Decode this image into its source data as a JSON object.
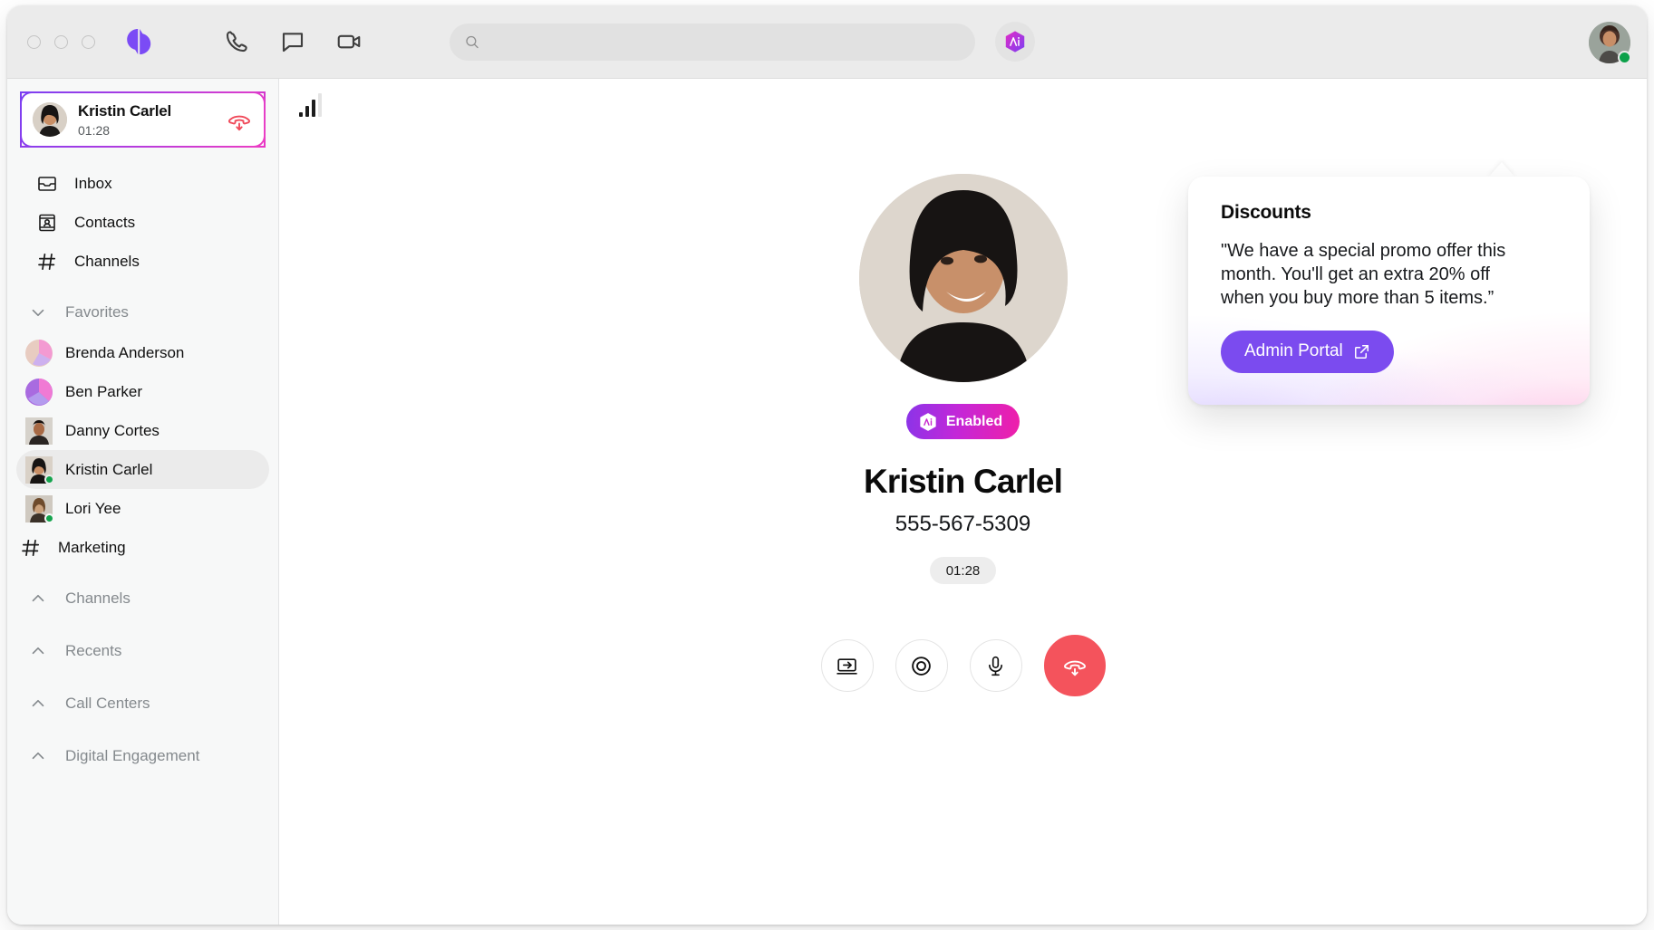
{
  "window": {
    "traffic_lights": [
      "close",
      "minimize",
      "maximize"
    ],
    "brand": "dialpad-logo"
  },
  "header": {
    "icons": [
      {
        "name": "phone-icon",
        "label": "Phone"
      },
      {
        "name": "message-icon",
        "label": "Messages"
      },
      {
        "name": "video-icon",
        "label": "Video"
      }
    ],
    "search": {
      "value": "",
      "placeholder": ""
    },
    "ai_badge": {
      "name": "ai-hexagon-icon",
      "glyph": "Ai"
    },
    "account_avatar": {
      "name": "user-avatar",
      "status": "online"
    }
  },
  "sidebar": {
    "active_call": {
      "name": "Kristin Carlel",
      "duration": "01:28",
      "end_call_label": "End call"
    },
    "nav": [
      {
        "label": "Inbox",
        "icon": "inbox-icon"
      },
      {
        "label": "Contacts",
        "icon": "contacts-icon"
      },
      {
        "label": "Channels",
        "icon": "hash-icon"
      }
    ],
    "favorites": {
      "label": "Favorites",
      "expanded": true,
      "items": [
        {
          "label": "Brenda Anderson",
          "type": "contact",
          "status": "offline",
          "avatar": "pie-avatar-warm"
        },
        {
          "label": "Ben Parker",
          "type": "contact",
          "status": "offline",
          "avatar": "pie-avatar-violet"
        },
        {
          "label": "Danny Cortes",
          "type": "contact",
          "status": "offline",
          "avatar": "photo-avatar-danny"
        },
        {
          "label": "Kristin Carlel",
          "type": "contact",
          "status": "online",
          "avatar": "photo-avatar-kristin",
          "active": true
        },
        {
          "label": "Lori Yee",
          "type": "contact",
          "status": "online",
          "avatar": "photo-avatar-lori"
        },
        {
          "label": "Marketing",
          "type": "channel",
          "icon": "hash-icon"
        }
      ]
    },
    "sections": [
      {
        "label": "Channels",
        "expanded": false
      },
      {
        "label": "Recents",
        "expanded": false
      },
      {
        "label": "Call Centers",
        "expanded": false
      },
      {
        "label": "Digital Engagement",
        "expanded": false
      }
    ]
  },
  "main": {
    "signal": {
      "name": "signal-strength-icon",
      "bars_total": 4,
      "bars_filled": 3
    },
    "call": {
      "caller_name": "Kristin Carlel",
      "caller_number": "555-567-5309",
      "duration": "01:28",
      "ai_badge_label": "Enabled",
      "ai_badge_icon": "ai-hexagon-icon"
    },
    "controls": [
      {
        "name": "screen-share-button",
        "label": "Share screen"
      },
      {
        "name": "record-button",
        "label": "Record"
      },
      {
        "name": "mute-mic-button",
        "label": "Mute"
      },
      {
        "name": "end-call-button",
        "label": "End call"
      }
    ]
  },
  "popup": {
    "title": "Discounts",
    "body": "\"We have a special promo offer this month. You'll get an extra 20% off when you buy more than 5 items.”",
    "button_label": "Admin Portal",
    "button_icon": "external-link-icon"
  },
  "colors": {
    "accent_purple": "#7b4bef",
    "gradient_start": "#8b34e8",
    "gradient_end": "#ef1fa9",
    "danger_red": "#f4535c",
    "online_green": "#14a44d",
    "sidebar_bg": "#f7f8f8",
    "titlebar_bg": "#ebebeb"
  }
}
